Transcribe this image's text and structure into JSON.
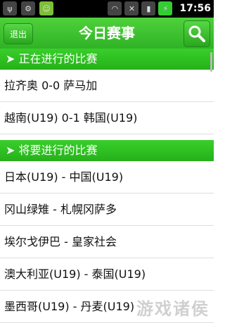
{
  "status": {
    "time": "17:56"
  },
  "header": {
    "exit_label": "退出",
    "title": "今日赛事"
  },
  "sections": {
    "live": "➤ 正在进行的比赛",
    "upcoming": "➤ 将要进行的比赛"
  },
  "live_matches": [
    "拉齐奥 0-0 萨马加",
    "越南(U19) 0-1 韩国(U19)"
  ],
  "upcoming_matches": [
    "日本(U19) - 中国(U19)",
    "冈山绿雉 - 札幌冈萨多",
    "埃尔戈伊巴 - 皇家社会",
    "澳大利亚(U19) - 泰国(U19)",
    "墨西哥(U19) - 丹麦(U19)"
  ],
  "watermark": "游戏诸侯"
}
